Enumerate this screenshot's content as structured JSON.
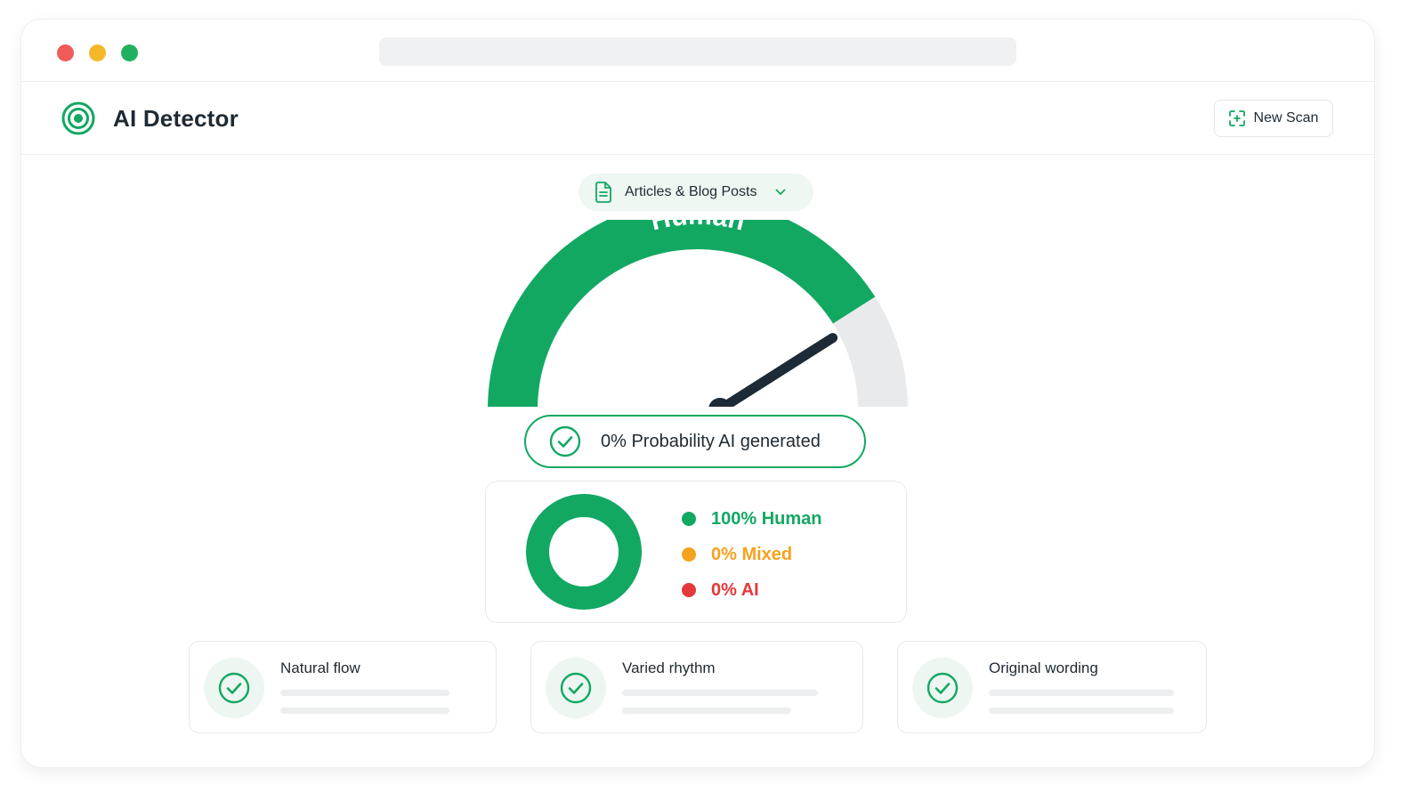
{
  "window": {
    "traffic_lights": {
      "close": "#ef5b57",
      "minimize": "#f5b72a",
      "zoom": "#1fb25e"
    }
  },
  "app": {
    "title": "AI Detector",
    "logo_icon": "target-icon",
    "new_scan": {
      "label": "New Scan",
      "icon": "scan-icon"
    }
  },
  "content_type": {
    "icon": "document-icon",
    "selected": "Articles & Blog Posts",
    "chevron": "chevron-down-icon"
  },
  "gauge": {
    "label": "Human",
    "human_fraction": 0.82,
    "needle_fraction": 0.82
  },
  "probability": {
    "icon": "check-circle-icon",
    "text": "0% Probability AI generated"
  },
  "breakdown": {
    "items": [
      {
        "label": "100% Human",
        "value": 100,
        "color": "#12a862"
      },
      {
        "label": "0% Mixed",
        "value": 0,
        "color": "#f4a21d"
      },
      {
        "label": "0% AI",
        "value": 0,
        "color": "#e5383b"
      }
    ]
  },
  "checks": [
    {
      "title": "Natural flow",
      "icon": "check-icon"
    },
    {
      "title": "Varied rhythm",
      "icon": "check-icon"
    },
    {
      "title": "Original wording",
      "icon": "check-icon"
    }
  ],
  "colors": {
    "accent": "#12a862",
    "needle": "#1c2b36",
    "track": "#e9eaeb"
  }
}
